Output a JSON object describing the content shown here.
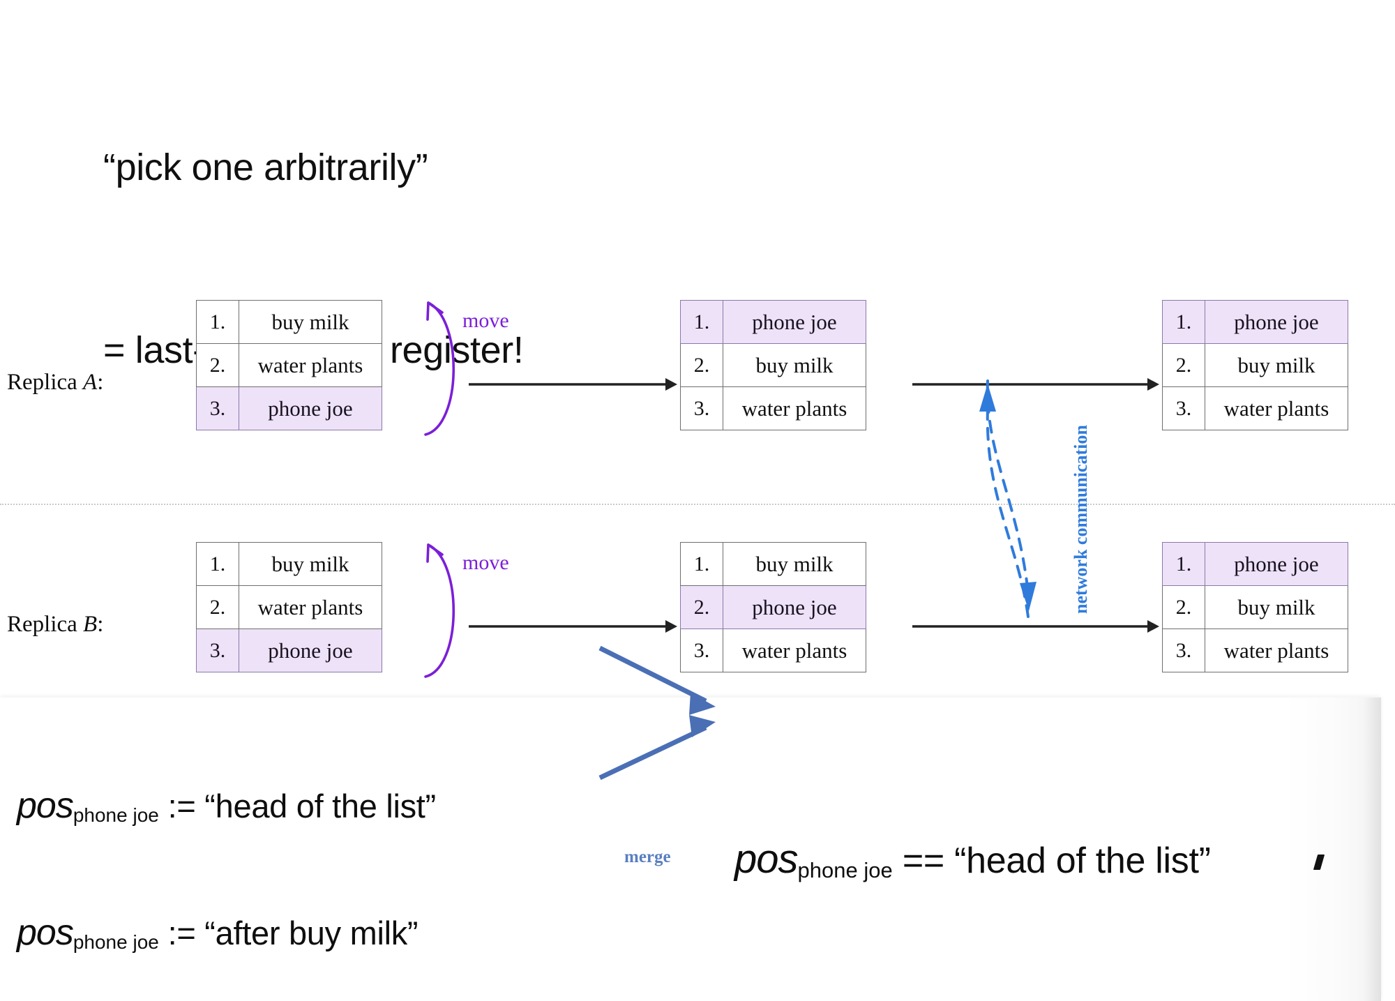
{
  "slide": {
    "title_line1": "“pick one arbitrarily”",
    "title_line2": "= last-writer wins register!"
  },
  "colors": {
    "highlight_fill": "#ede2f7",
    "highlight_border": "#8a79a8",
    "move_arrow": "#7b1fd8",
    "network_arrow": "#2f7bdb",
    "merge_arrow": "#4a6fb5",
    "merge_label": "#5a7fc0",
    "table_border": "#6e6e6e",
    "separator": "#c9c9c9"
  },
  "replicas": [
    {
      "label_prefix": "Replica ",
      "label_name": "A",
      "label_suffix": ":",
      "move_label": "move",
      "tables": [
        {
          "name": "replica-a-before",
          "rows": [
            {
              "num": "1.",
              "text": "buy milk",
              "highlight": false
            },
            {
              "num": "2.",
              "text": "water plants",
              "highlight": false
            },
            {
              "num": "3.",
              "text": "phone joe",
              "highlight": true
            }
          ]
        },
        {
          "name": "replica-a-after-move",
          "rows": [
            {
              "num": "1.",
              "text": "phone joe",
              "highlight": true
            },
            {
              "num": "2.",
              "text": "buy milk",
              "highlight": false
            },
            {
              "num": "3.",
              "text": "water plants",
              "highlight": false
            }
          ]
        },
        {
          "name": "replica-a-after-merge",
          "rows": [
            {
              "num": "1.",
              "text": "phone joe",
              "highlight": true
            },
            {
              "num": "2.",
              "text": "buy milk",
              "highlight": false
            },
            {
              "num": "3.",
              "text": "water plants",
              "highlight": false
            }
          ]
        }
      ]
    },
    {
      "label_prefix": "Replica ",
      "label_name": "B",
      "label_suffix": ":",
      "move_label": "move",
      "tables": [
        {
          "name": "replica-b-before",
          "rows": [
            {
              "num": "1.",
              "text": "buy milk",
              "highlight": false
            },
            {
              "num": "2.",
              "text": "water plants",
              "highlight": false
            },
            {
              "num": "3.",
              "text": "phone joe",
              "highlight": true
            }
          ]
        },
        {
          "name": "replica-b-after-move",
          "rows": [
            {
              "num": "1.",
              "text": "buy milk",
              "highlight": false
            },
            {
              "num": "2.",
              "text": "phone joe",
              "highlight": true
            },
            {
              "num": "3.",
              "text": "water plants",
              "highlight": false
            }
          ]
        },
        {
          "name": "replica-b-after-merge",
          "rows": [
            {
              "num": "1.",
              "text": "phone joe",
              "highlight": true
            },
            {
              "num": "2.",
              "text": "buy milk",
              "highlight": false
            },
            {
              "num": "3.",
              "text": "water plants",
              "highlight": false
            }
          ]
        }
      ]
    }
  ],
  "network": {
    "label": "network communication"
  },
  "bottom": {
    "formula_a": {
      "var": "pos",
      "subscript": "phone joe",
      "operator": ":=",
      "value": "“head of the list”"
    },
    "formula_b": {
      "var": "pos",
      "subscript": "phone joe",
      "operator": ":=",
      "value": "“after buy milk”"
    },
    "merge_label": "merge",
    "formula_result": {
      "var": "pos",
      "subscript": "phone joe",
      "operator": "==",
      "value": "“head of the list”"
    }
  }
}
